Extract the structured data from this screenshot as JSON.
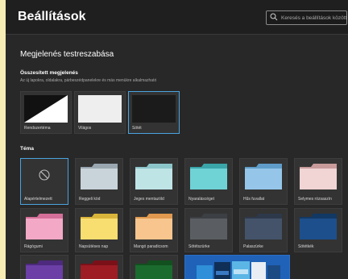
{
  "header": {
    "title": "Beállítások",
    "search_placeholder": "Keresés a beállítások között"
  },
  "section_title": "Megjelenés testreszabása",
  "combined": {
    "title": "Összesített megjelenés",
    "description": "Az új lapokra, oldalakra, párbeszédpanelekre és más menükre alkalmazható",
    "options": [
      {
        "label": "Rendszertéma",
        "selected": false
      },
      {
        "label": "Világos",
        "selected": false
      },
      {
        "label": "Sötét",
        "selected": true
      }
    ]
  },
  "themes": {
    "title": "Téma",
    "items": [
      {
        "label": "Alapértelmezett",
        "selected": true,
        "color": ""
      },
      {
        "label": "Reggeli köd",
        "selected": false,
        "color": "#c9d3da"
      },
      {
        "label": "Jeges mentazöld",
        "selected": false,
        "color": "#bfe4e6"
      },
      {
        "label": "Nyaraláscéget",
        "selected": false,
        "color": "#6fd3d6"
      },
      {
        "label": "Hűs fuvallat",
        "selected": false,
        "color": "#95c6ea"
      },
      {
        "label": "Selymes rózsaszín",
        "selected": false,
        "color": "#f1d4d4"
      },
      {
        "label": "Rágógumi",
        "selected": false,
        "color": "#f3a8c6"
      },
      {
        "label": "Napsütéses nap",
        "selected": false,
        "color": "#f8dd70"
      },
      {
        "label": "Mangó paradicsom",
        "selected": false,
        "color": "#f7c58d"
      },
      {
        "label": "Sötétszürke",
        "selected": false,
        "color": "#5a5e63"
      },
      {
        "label": "Palaszürke",
        "selected": false,
        "color": "#44536a"
      },
      {
        "label": "Sötétkék",
        "selected": false,
        "color": "#1d4f8c"
      },
      {
        "label": "",
        "selected": false,
        "color": "#6b3fa6"
      },
      {
        "label": "",
        "selected": false,
        "color": "#9e1c24"
      },
      {
        "label": "",
        "selected": false,
        "color": "#1b6b2e"
      }
    ]
  },
  "colors": {
    "accent": "#4aa3df",
    "window_bg": "#282828",
    "page_bg": "#f7ecb4"
  }
}
